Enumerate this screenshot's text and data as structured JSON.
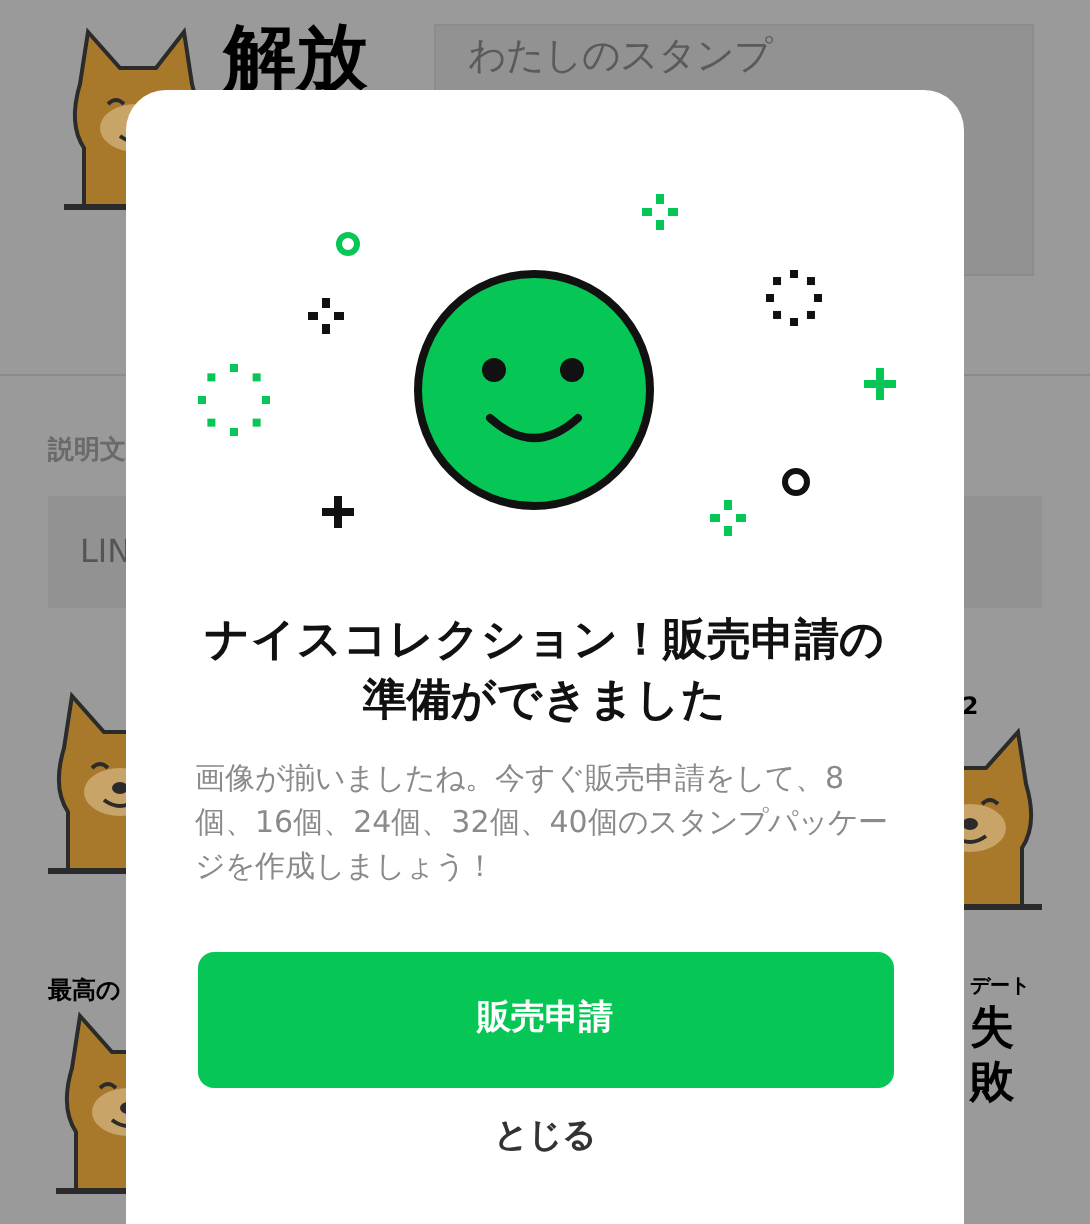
{
  "background": {
    "sticker_title": "解放",
    "title_field": {
      "value": "わたしのスタンプ"
    },
    "description_label": "説明文",
    "description_field": {
      "value": "LIN"
    },
    "sticker_captions": [
      "2",
      "最高の",
      "デート",
      "失",
      "敗"
    ]
  },
  "dialog": {
    "title": "ナイスコレクション！販売申請の準備ができました",
    "message": "画像が揃いましたね。今すぐ販売申請をして、8個、16個、24個、32個、40個のスタンプパッケージを作成しましょう！",
    "primary_button": "販売申請",
    "close_button": "とじる"
  }
}
